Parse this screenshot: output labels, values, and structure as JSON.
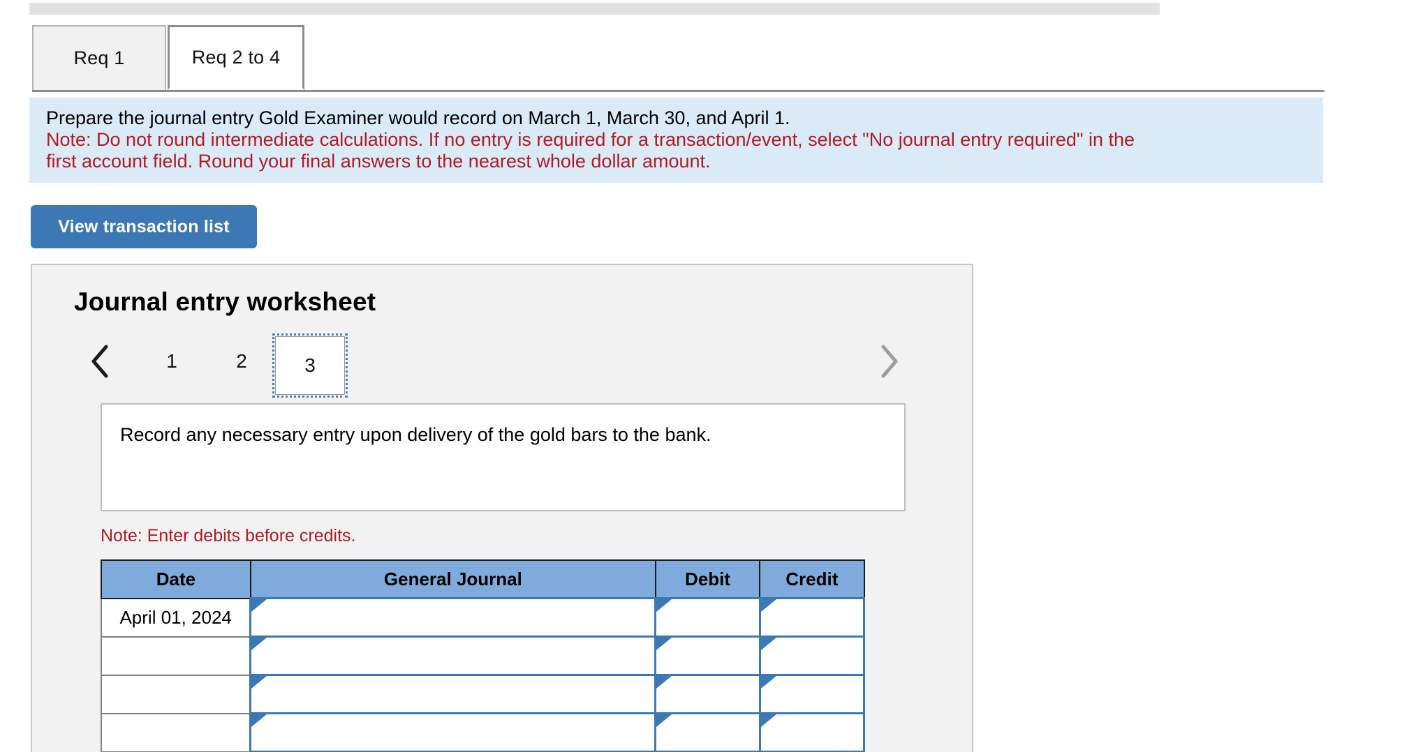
{
  "tabs": [
    {
      "label": "Req 1",
      "active": false
    },
    {
      "label": "Req 2 to 4",
      "active": true
    }
  ],
  "banner": {
    "instruction": "Prepare the journal entry Gold Examiner would record on March 1, March 30, and April 1.",
    "note_line1": "Note: Do not round intermediate calculations. If no entry is required for a transaction/event, select \"No journal entry required\" in the",
    "note_line2": "first account field. Round your final answers to the nearest whole dollar amount."
  },
  "toolbar": {
    "view_transaction_list_label": "View transaction list"
  },
  "worksheet": {
    "title": "Journal entry worksheet",
    "pager": {
      "prev_icon": "chevron-left-icon",
      "next_icon": "chevron-right-icon",
      "pages": [
        "1",
        "2",
        "3"
      ],
      "selected_page": "3"
    },
    "transaction_text": "Record any necessary entry upon delivery of the gold bars to the bank.",
    "debits_note": "Note: Enter debits before credits.",
    "table": {
      "headers": [
        "Date",
        "General Journal",
        "Debit",
        "Credit"
      ],
      "rows": [
        {
          "date": "April 01, 2024",
          "general_journal": "",
          "debit": "",
          "credit": ""
        },
        {
          "date": "",
          "general_journal": "",
          "debit": "",
          "credit": ""
        },
        {
          "date": "",
          "general_journal": "",
          "debit": "",
          "credit": ""
        },
        {
          "date": "",
          "general_journal": "",
          "debit": "",
          "credit": ""
        }
      ]
    }
  },
  "colors": {
    "accent_blue": "#3b78b4",
    "banner_bg": "#daeaf7",
    "note_red": "#b01b22",
    "table_header_blue": "#7eabdc"
  }
}
